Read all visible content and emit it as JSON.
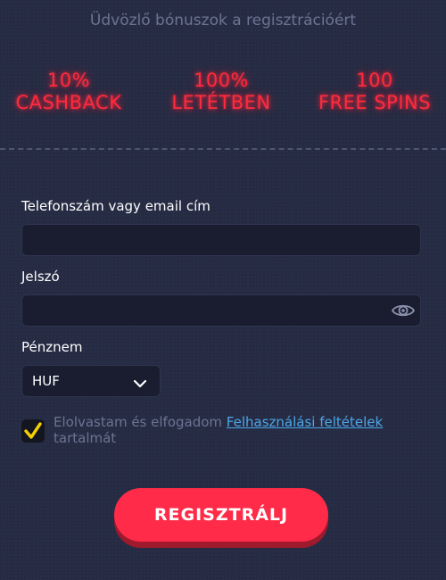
{
  "header": {
    "title": "Üdvözlő bónuszok a regisztrációért"
  },
  "bonuses": [
    {
      "line1": "10%",
      "line2": "CASHBACK"
    },
    {
      "line1": "100%",
      "line2": "LETÉTBEN"
    },
    {
      "line1": "100",
      "line2": "FREE SPINS"
    }
  ],
  "form": {
    "login_label": "Telefonszám vagy email cím",
    "login_value": "",
    "password_label": "Jelszó",
    "password_value": "",
    "password_toggle_icon": "eye-icon",
    "currency_label": "Pénznem",
    "currency_value": "HUF",
    "currency_icon": "chevron-down-icon",
    "terms_checked": true,
    "terms_prefix": "Elolvastam és elfogadom ",
    "terms_link": "Felhasználási feltételek",
    "terms_suffix": "tartalmát",
    "submit_label": "REGISZTRÁLJ"
  },
  "colors": {
    "background": "#262b44",
    "neon_red": "#ff2a3d",
    "checkbox_yellow": "#f5d000",
    "link_blue": "#4aa7e8",
    "button_red": "#ff2b48"
  }
}
